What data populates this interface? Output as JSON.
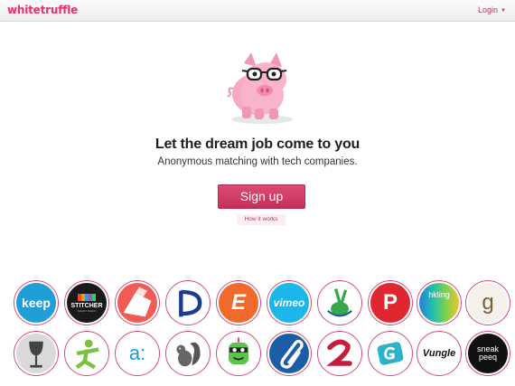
{
  "header": {
    "brand": "whitetruffle",
    "login_label": "Login"
  },
  "hero": {
    "headline": "Let the dream job come to you",
    "subheadline": "Anonymous matching with tech companies.",
    "signup_label": "Sign up",
    "how_it_works_label": "How it works"
  },
  "logos": {
    "keep": "keep",
    "stitcher": "STITCHER",
    "stitcher_sub": "SMART RADIO",
    "evernote": "E",
    "vimeo": "vimeo",
    "pinterest": "P",
    "hkling": "hkling",
    "goodreads": "g",
    "appnexus": "a:",
    "vungle": "Vungle",
    "sneakpeeq_1": "sneak",
    "sneakpeeq_2": "peeq"
  },
  "colors": {
    "brand": "#e8306b",
    "signup_button": "#d23f68",
    "logo_ring": "#d84e7e"
  }
}
